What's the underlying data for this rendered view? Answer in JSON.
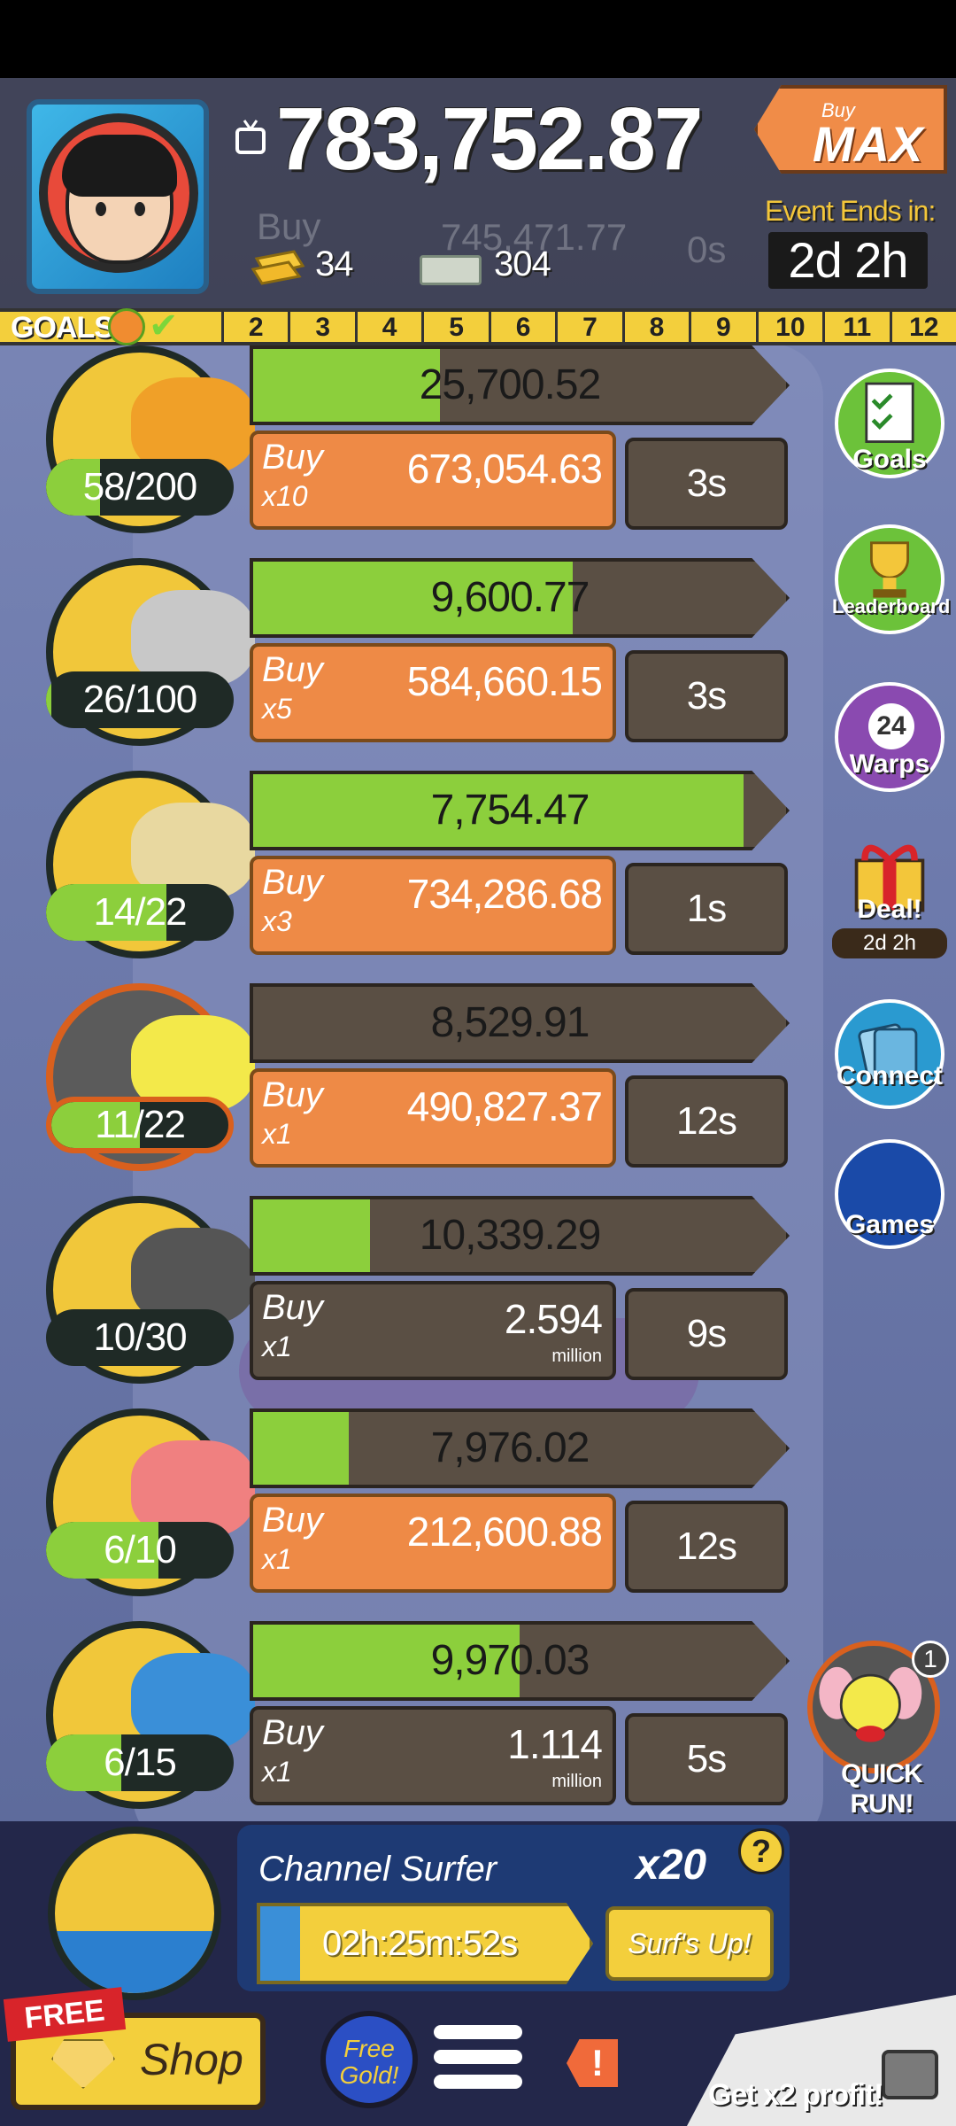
{
  "header": {
    "cash": "783,752.87",
    "gold_count": "34",
    "megabucks_count": "304",
    "ghost_buy": "Buy",
    "ghost_price": "745,471.77",
    "ghost_timer": "0s",
    "buy_max_small": "Buy",
    "buy_max_big": "MAX",
    "event_ends_label": "Event Ends in:",
    "event_ends_time": "2d 2h"
  },
  "goals": {
    "label": "GOALS",
    "ticks": [
      "2",
      "3",
      "4",
      "5",
      "6",
      "7",
      "8",
      "9",
      "10",
      "11",
      "12"
    ]
  },
  "businesses": [
    {
      "count": "58/200",
      "count_fill": 0.29,
      "income": "25,700.52",
      "progress": 0.35,
      "buy": "Buy",
      "mult": "x10",
      "price": "673,054.63",
      "unit": "",
      "timer": "3s",
      "buy_color": "orange"
    },
    {
      "count": "26/100",
      "count_fill": 0.03,
      "income": "9,600.77",
      "progress": 0.6,
      "buy": "Buy",
      "mult": "x5",
      "price": "584,660.15",
      "unit": "",
      "timer": "3s",
      "buy_color": "orange"
    },
    {
      "count": "14/22",
      "count_fill": 0.64,
      "income": "7,754.47",
      "progress": 0.92,
      "buy": "Buy",
      "mult": "x3",
      "price": "734,286.68",
      "unit": "",
      "timer": "1s",
      "buy_color": "orange"
    },
    {
      "count": "11/22",
      "count_fill": 0.5,
      "income": "8,529.91",
      "progress": 0.0,
      "buy": "Buy",
      "mult": "x1",
      "price": "490,827.37",
      "unit": "",
      "timer": "12s",
      "buy_color": "orange"
    },
    {
      "count": "10/30",
      "count_fill": 0.0,
      "income": "10,339.29",
      "progress": 0.22,
      "buy": "Buy",
      "mult": "x1",
      "price": "2.594",
      "unit": "million",
      "timer": "9s",
      "buy_color": "gray"
    },
    {
      "count": "6/10",
      "count_fill": 0.6,
      "income": "7,976.02",
      "progress": 0.18,
      "buy": "Buy",
      "mult": "x1",
      "price": "212,600.88",
      "unit": "",
      "timer": "12s",
      "buy_color": "orange"
    },
    {
      "count": "6/15",
      "count_fill": 0.4,
      "income": "9,970.03",
      "progress": 0.5,
      "buy": "Buy",
      "mult": "x1",
      "price": "1.114",
      "unit": "million",
      "timer": "5s",
      "buy_color": "gray"
    }
  ],
  "side_buttons": {
    "goals": "Goals",
    "leaderboard": "Leaderboard",
    "warps": "Warps",
    "warps_count": "24",
    "deal": "Deal!",
    "deal_time": "2d 2h",
    "connect": "Connect",
    "games": "Games"
  },
  "quick_run": {
    "label": "QUICK RUN!",
    "count": "1"
  },
  "event": {
    "name": "Channel Surfer",
    "multiplier": "x20",
    "help": "?",
    "timer": "02h:25m:52s",
    "timer_progress": 0.12,
    "action": "Surf's Up!"
  },
  "footer": {
    "free_tag": "FREE",
    "shop": "Shop",
    "free_gold": "Free Gold!",
    "alert": "!",
    "x2_profit": "Get x2 profit!"
  },
  "colors": {
    "orange": "#ee8a46",
    "green": "#8ccf3c",
    "yellow": "#f3cf3c",
    "brown": "#5a4f44"
  }
}
